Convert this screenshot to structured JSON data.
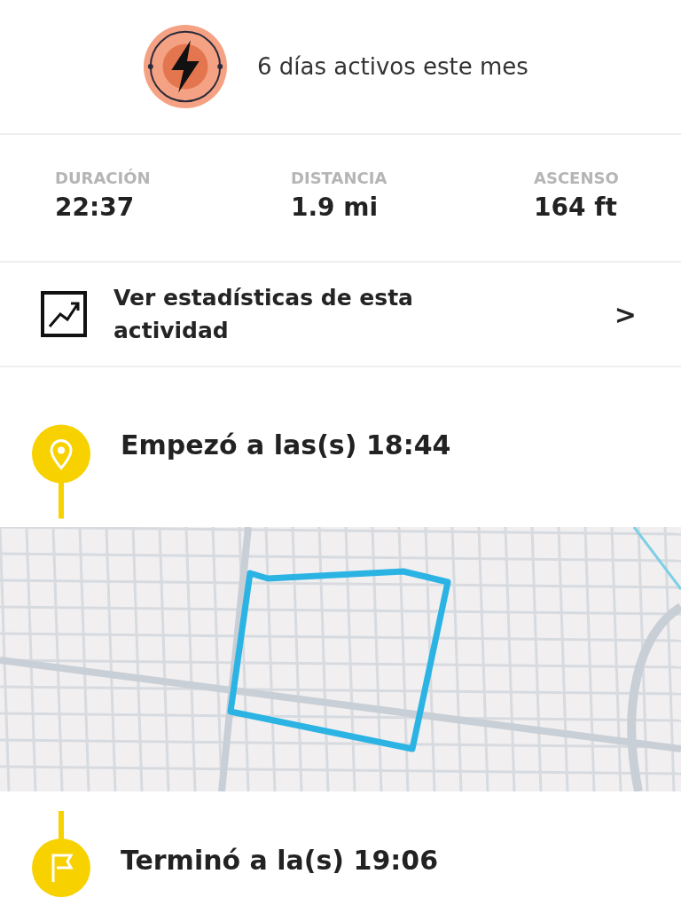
{
  "streak": {
    "text": "6 días activos este mes"
  },
  "stats": [
    {
      "label": "DURACIÓN",
      "value": "22:37"
    },
    {
      "label": "DISTANCIA",
      "value": "1.9 mi"
    },
    {
      "label": "ASCENSO",
      "value": "164 ft"
    }
  ],
  "stats_link": {
    "text": "Ver estadísticas de esta actividad",
    "chevron": ">"
  },
  "timeline": [
    {
      "kind": "start",
      "text": "Empezó a las(s) 18:44"
    },
    {
      "kind": "map"
    },
    {
      "kind": "end",
      "text": "Terminó a la(s) 19:06"
    }
  ]
}
